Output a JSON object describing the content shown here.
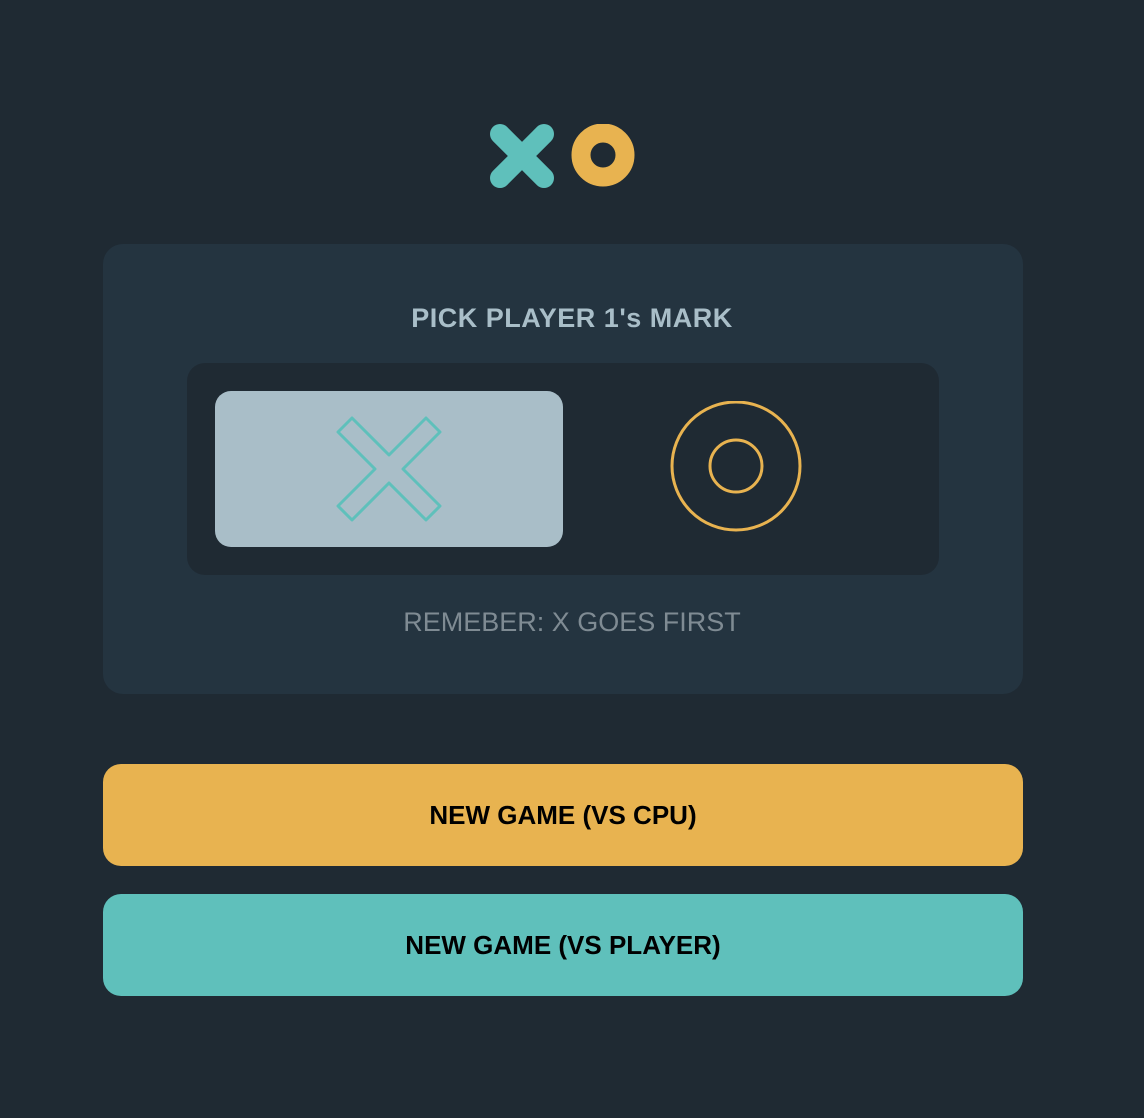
{
  "logo": {
    "x_icon": "x-mark-icon",
    "o_icon": "o-mark-icon",
    "x_color": "#5fc0bb",
    "o_color": "#e8b350"
  },
  "picker": {
    "title": "PICK PLAYER 1's MARK",
    "options": [
      {
        "mark": "X",
        "icon": "x-outline-icon",
        "selected": true
      },
      {
        "mark": "O",
        "icon": "o-outline-icon",
        "selected": false
      }
    ],
    "hint": "REMEBER: X GOES FIRST"
  },
  "buttons": {
    "vs_cpu": "NEW GAME (VS CPU)",
    "vs_player": "NEW GAME (VS PLAYER)"
  },
  "colors": {
    "background": "#1f2a33",
    "card": "#243440",
    "selected_option": "#a9bec8",
    "accent_yellow": "#e8b350",
    "accent_teal": "#5fc0bb"
  }
}
